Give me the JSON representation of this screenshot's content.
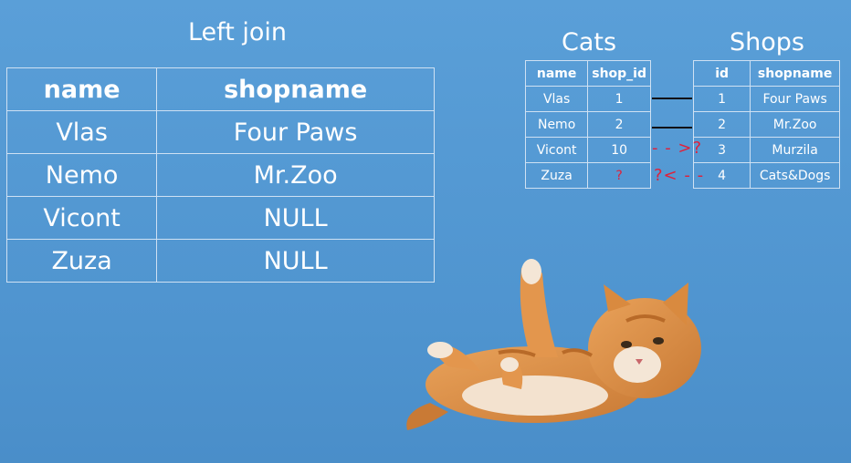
{
  "left_join": {
    "title": "Left join",
    "headers": [
      "name",
      "shopname"
    ],
    "rows": [
      [
        "Vlas",
        "Four Paws"
      ],
      [
        "Nemo",
        "Mr.Zoo"
      ],
      [
        "Vicont",
        "NULL"
      ],
      [
        "Zuza",
        "NULL"
      ]
    ]
  },
  "cats": {
    "title": "Cats",
    "headers": [
      "name",
      "shop_id"
    ],
    "rows": [
      [
        "Vlas",
        "1"
      ],
      [
        "Nemo",
        "2"
      ],
      [
        "Vicont",
        "10"
      ],
      [
        "Zuza",
        "?"
      ]
    ]
  },
  "shops": {
    "title": "Shops",
    "headers": [
      "id",
      "shopname"
    ],
    "rows": [
      [
        "1",
        "Four Paws"
      ],
      [
        "2",
        "Mr.Zoo"
      ],
      [
        "3",
        "Murzila"
      ],
      [
        "4",
        "Cats&Dogs"
      ]
    ]
  },
  "markers": {
    "vicont_to_unknown": "- - >?",
    "unknown_from_zuza": "?< - -"
  },
  "colors": {
    "background": "#5a9fd8",
    "grid_line": "#cfe1f3",
    "link_line": "#111111",
    "question_mark": "#e0203a",
    "cat_fur": "#d98a3f"
  }
}
